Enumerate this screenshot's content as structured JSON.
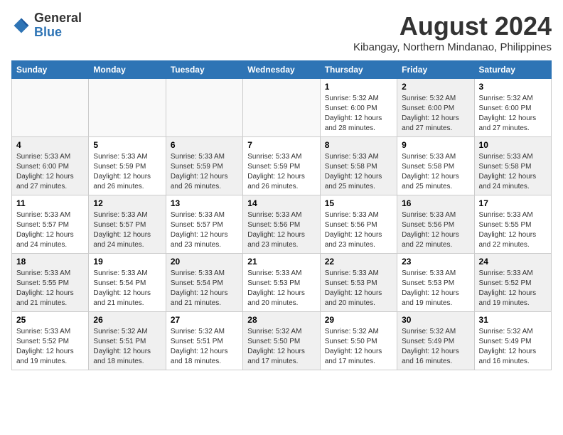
{
  "header": {
    "logo_general": "General",
    "logo_blue": "Blue",
    "main_title": "August 2024",
    "subtitle": "Kibangay, Northern Mindanao, Philippines"
  },
  "weekdays": [
    "Sunday",
    "Monday",
    "Tuesday",
    "Wednesday",
    "Thursday",
    "Friday",
    "Saturday"
  ],
  "weeks": [
    {
      "cells": [
        {
          "day": "",
          "content": "",
          "shaded": true
        },
        {
          "day": "",
          "content": "",
          "shaded": true
        },
        {
          "day": "",
          "content": "",
          "shaded": true
        },
        {
          "day": "",
          "content": "",
          "shaded": true
        },
        {
          "day": "1",
          "content": "Sunrise: 5:32 AM\nSunset: 6:00 PM\nDaylight: 12 hours\nand 28 minutes.",
          "shaded": false
        },
        {
          "day": "2",
          "content": "Sunrise: 5:32 AM\nSunset: 6:00 PM\nDaylight: 12 hours\nand 27 minutes.",
          "shaded": true
        },
        {
          "day": "3",
          "content": "Sunrise: 5:32 AM\nSunset: 6:00 PM\nDaylight: 12 hours\nand 27 minutes.",
          "shaded": false
        }
      ]
    },
    {
      "cells": [
        {
          "day": "4",
          "content": "Sunrise: 5:33 AM\nSunset: 6:00 PM\nDaylight: 12 hours\nand 27 minutes.",
          "shaded": true
        },
        {
          "day": "5",
          "content": "Sunrise: 5:33 AM\nSunset: 5:59 PM\nDaylight: 12 hours\nand 26 minutes.",
          "shaded": false
        },
        {
          "day": "6",
          "content": "Sunrise: 5:33 AM\nSunset: 5:59 PM\nDaylight: 12 hours\nand 26 minutes.",
          "shaded": true
        },
        {
          "day": "7",
          "content": "Sunrise: 5:33 AM\nSunset: 5:59 PM\nDaylight: 12 hours\nand 26 minutes.",
          "shaded": false
        },
        {
          "day": "8",
          "content": "Sunrise: 5:33 AM\nSunset: 5:58 PM\nDaylight: 12 hours\nand 25 minutes.",
          "shaded": true
        },
        {
          "day": "9",
          "content": "Sunrise: 5:33 AM\nSunset: 5:58 PM\nDaylight: 12 hours\nand 25 minutes.",
          "shaded": false
        },
        {
          "day": "10",
          "content": "Sunrise: 5:33 AM\nSunset: 5:58 PM\nDaylight: 12 hours\nand 24 minutes.",
          "shaded": true
        }
      ]
    },
    {
      "cells": [
        {
          "day": "11",
          "content": "Sunrise: 5:33 AM\nSunset: 5:57 PM\nDaylight: 12 hours\nand 24 minutes.",
          "shaded": false
        },
        {
          "day": "12",
          "content": "Sunrise: 5:33 AM\nSunset: 5:57 PM\nDaylight: 12 hours\nand 24 minutes.",
          "shaded": true
        },
        {
          "day": "13",
          "content": "Sunrise: 5:33 AM\nSunset: 5:57 PM\nDaylight: 12 hours\nand 23 minutes.",
          "shaded": false
        },
        {
          "day": "14",
          "content": "Sunrise: 5:33 AM\nSunset: 5:56 PM\nDaylight: 12 hours\nand 23 minutes.",
          "shaded": true
        },
        {
          "day": "15",
          "content": "Sunrise: 5:33 AM\nSunset: 5:56 PM\nDaylight: 12 hours\nand 23 minutes.",
          "shaded": false
        },
        {
          "day": "16",
          "content": "Sunrise: 5:33 AM\nSunset: 5:56 PM\nDaylight: 12 hours\nand 22 minutes.",
          "shaded": true
        },
        {
          "day": "17",
          "content": "Sunrise: 5:33 AM\nSunset: 5:55 PM\nDaylight: 12 hours\nand 22 minutes.",
          "shaded": false
        }
      ]
    },
    {
      "cells": [
        {
          "day": "18",
          "content": "Sunrise: 5:33 AM\nSunset: 5:55 PM\nDaylight: 12 hours\nand 21 minutes.",
          "shaded": true
        },
        {
          "day": "19",
          "content": "Sunrise: 5:33 AM\nSunset: 5:54 PM\nDaylight: 12 hours\nand 21 minutes.",
          "shaded": false
        },
        {
          "day": "20",
          "content": "Sunrise: 5:33 AM\nSunset: 5:54 PM\nDaylight: 12 hours\nand 21 minutes.",
          "shaded": true
        },
        {
          "day": "21",
          "content": "Sunrise: 5:33 AM\nSunset: 5:53 PM\nDaylight: 12 hours\nand 20 minutes.",
          "shaded": false
        },
        {
          "day": "22",
          "content": "Sunrise: 5:33 AM\nSunset: 5:53 PM\nDaylight: 12 hours\nand 20 minutes.",
          "shaded": true
        },
        {
          "day": "23",
          "content": "Sunrise: 5:33 AM\nSunset: 5:53 PM\nDaylight: 12 hours\nand 19 minutes.",
          "shaded": false
        },
        {
          "day": "24",
          "content": "Sunrise: 5:33 AM\nSunset: 5:52 PM\nDaylight: 12 hours\nand 19 minutes.",
          "shaded": true
        }
      ]
    },
    {
      "cells": [
        {
          "day": "25",
          "content": "Sunrise: 5:33 AM\nSunset: 5:52 PM\nDaylight: 12 hours\nand 19 minutes.",
          "shaded": false
        },
        {
          "day": "26",
          "content": "Sunrise: 5:32 AM\nSunset: 5:51 PM\nDaylight: 12 hours\nand 18 minutes.",
          "shaded": true
        },
        {
          "day": "27",
          "content": "Sunrise: 5:32 AM\nSunset: 5:51 PM\nDaylight: 12 hours\nand 18 minutes.",
          "shaded": false
        },
        {
          "day": "28",
          "content": "Sunrise: 5:32 AM\nSunset: 5:50 PM\nDaylight: 12 hours\nand 17 minutes.",
          "shaded": true
        },
        {
          "day": "29",
          "content": "Sunrise: 5:32 AM\nSunset: 5:50 PM\nDaylight: 12 hours\nand 17 minutes.",
          "shaded": false
        },
        {
          "day": "30",
          "content": "Sunrise: 5:32 AM\nSunset: 5:49 PM\nDaylight: 12 hours\nand 16 minutes.",
          "shaded": true
        },
        {
          "day": "31",
          "content": "Sunrise: 5:32 AM\nSunset: 5:49 PM\nDaylight: 12 hours\nand 16 minutes.",
          "shaded": false
        }
      ]
    }
  ]
}
